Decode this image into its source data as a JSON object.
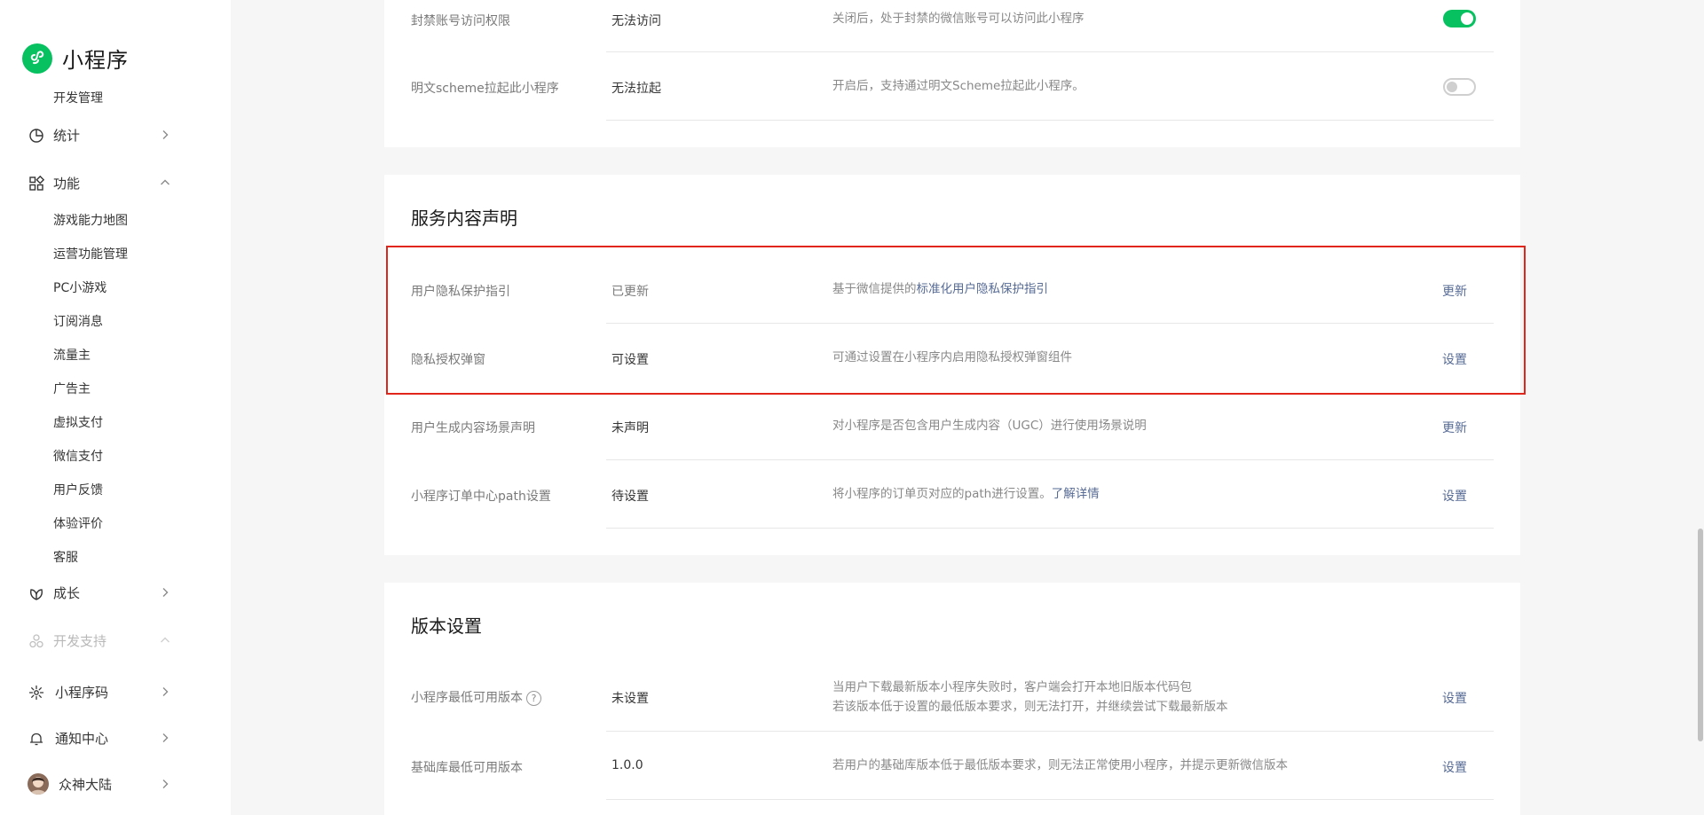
{
  "sidebar": {
    "brand": "小程序",
    "sub_top": "开发管理",
    "stats": {
      "label": "统计"
    },
    "features": {
      "label": "功能",
      "items": [
        "游戏能力地图",
        "运营功能管理",
        "PC小游戏",
        "订阅消息",
        "流量主",
        "广告主",
        "虚拟支付",
        "微信支付",
        "用户反馈",
        "体验评价",
        "客服"
      ]
    },
    "growth": {
      "label": "成长"
    },
    "dev_support": {
      "label": "开发支持"
    },
    "qrcode": {
      "label": "小程序码"
    },
    "notify": {
      "label": "通知中心"
    },
    "account": {
      "label": "众神大陆"
    }
  },
  "top_card": {
    "rows": [
      {
        "label": "封禁账号访问权限",
        "value": "无法访问",
        "desc": "关闭后，处于封禁的微信账号可以访问此小程序",
        "toggle": "on"
      },
      {
        "label": "明文scheme拉起此小程序",
        "value": "无法拉起",
        "desc": "开启后，支持通过明文Scheme拉起此小程序。",
        "toggle": "off"
      }
    ]
  },
  "service_card": {
    "title": "服务内容声明",
    "rows": [
      {
        "label": "用户隐私保护指引",
        "value": "已更新",
        "desc_prefix": "基于微信提供的",
        "desc_link": "标准化用户隐私保护指引",
        "action": "更新"
      },
      {
        "label": "隐私授权弹窗",
        "value": "可设置",
        "desc": "可通过设置在小程序内启用隐私授权弹窗组件",
        "action": "设置"
      },
      {
        "label": "用户生成内容场景声明",
        "value": "未声明",
        "desc": "对小程序是否包含用户生成内容（UGC）进行使用场景说明",
        "action": "更新"
      },
      {
        "label": "小程序订单中心path设置",
        "value": "待设置",
        "desc_prefix": "将小程序的订单页对应的path进行设置。",
        "desc_link": "了解详情",
        "action": "设置"
      }
    ]
  },
  "version_card": {
    "title": "版本设置",
    "rows": [
      {
        "label": "小程序最低可用版本",
        "help": "?",
        "value": "未设置",
        "desc_line1": "当用户下载最新版本小程序失败时，客户端会打开本地旧版本代码包",
        "desc_line2": "若该版本低于设置的最低版本要求，则无法打开，并继续尝试下载最新版本",
        "action": "设置"
      },
      {
        "label": "基础库最低可用版本",
        "value": "1.0.0",
        "desc": "若用户的基础库版本低于最低版本要求，则无法正常使用小程序，并提示更新微信版本",
        "action": "设置"
      }
    ]
  },
  "colors": {
    "accent": "#07c160",
    "link": "#576b95",
    "highlight": "#e1251b"
  }
}
